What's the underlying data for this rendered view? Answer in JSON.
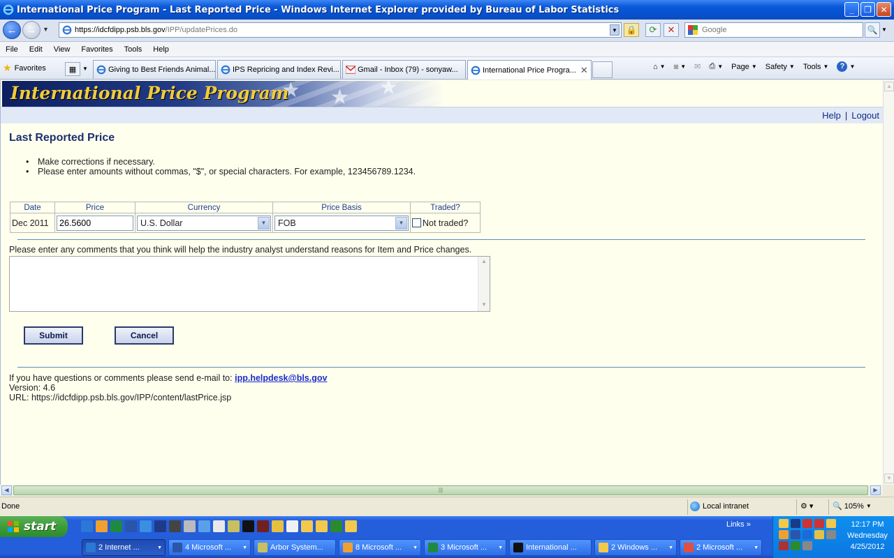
{
  "window": {
    "title": "International Price Program - Last Reported Price - Windows Internet Explorer provided by Bureau of Labor Statistics"
  },
  "address": {
    "url_main": "https://idcfdipp.psb.bls.gov",
    "url_path": "/IPP/updatePrices.do",
    "search_placeholder": "Google"
  },
  "menu": [
    "File",
    "Edit",
    "View",
    "Favorites",
    "Tools",
    "Help"
  ],
  "favorites_label": "Favorites",
  "tabs": [
    {
      "label": "Giving to Best Friends Animal..."
    },
    {
      "label": "IPS Repricing and Index Revi..."
    },
    {
      "label": "Gmail - Inbox (79) - sonyaw..."
    },
    {
      "label": "International Price Progra..."
    }
  ],
  "command_bar": {
    "page": "Page",
    "safety": "Safety",
    "tools": "Tools"
  },
  "banner": {
    "title": "International Price Program"
  },
  "topnav": {
    "help": "Help",
    "logout": "Logout"
  },
  "page": {
    "title": "Last Reported Price",
    "instructions": [
      "Make corrections if necessary.",
      "Please enter amounts without commas, \"$\", or special characters. For example, 123456789.1234."
    ]
  },
  "table": {
    "headers": {
      "date": "Date",
      "price": "Price",
      "currency": "Currency",
      "basis": "Price Basis",
      "traded": "Traded?"
    },
    "row": {
      "date": "Dec 2011",
      "price": "26.5600",
      "currency": "U.S. Dollar",
      "basis": "FOB",
      "not_traded_label": "Not traded?"
    }
  },
  "comments": {
    "label": "Please enter any comments that you think will help the industry analyst understand reasons for Item and Price changes.",
    "value": ""
  },
  "buttons": {
    "submit": "Submit",
    "cancel": "Cancel"
  },
  "footer": {
    "contact_text": "If you have questions or comments please send e-mail to:",
    "email": "ipp.helpdesk@bls.gov",
    "version": "Version: 4.6",
    "url": "URL: https://idcfdipp.psb.bls.gov/IPP/content/lastPrice.jsp"
  },
  "status": {
    "text": "Done",
    "zone": "Local intranet",
    "zoom": "105%"
  },
  "taskbar": {
    "start": "start",
    "links": "Links",
    "buttons": [
      {
        "label": "2 Internet ..."
      },
      {
        "label": "4 Microsoft ..."
      },
      {
        "label": "Arbor System..."
      },
      {
        "label": "8 Microsoft ..."
      },
      {
        "label": "3 Microsoft ..."
      },
      {
        "label": "International ..."
      },
      {
        "label": "2 Windows ..."
      },
      {
        "label": "2 Microsoft ..."
      }
    ],
    "clock": {
      "time": "12:17 PM",
      "day": "Wednesday",
      "date": "4/25/2012"
    }
  },
  "colors": {
    "content_bg": "#ffffee",
    "banner_text": "#f1cc3a",
    "title_text": "#1c2f6e",
    "link_blue": "#1a2bcc"
  }
}
